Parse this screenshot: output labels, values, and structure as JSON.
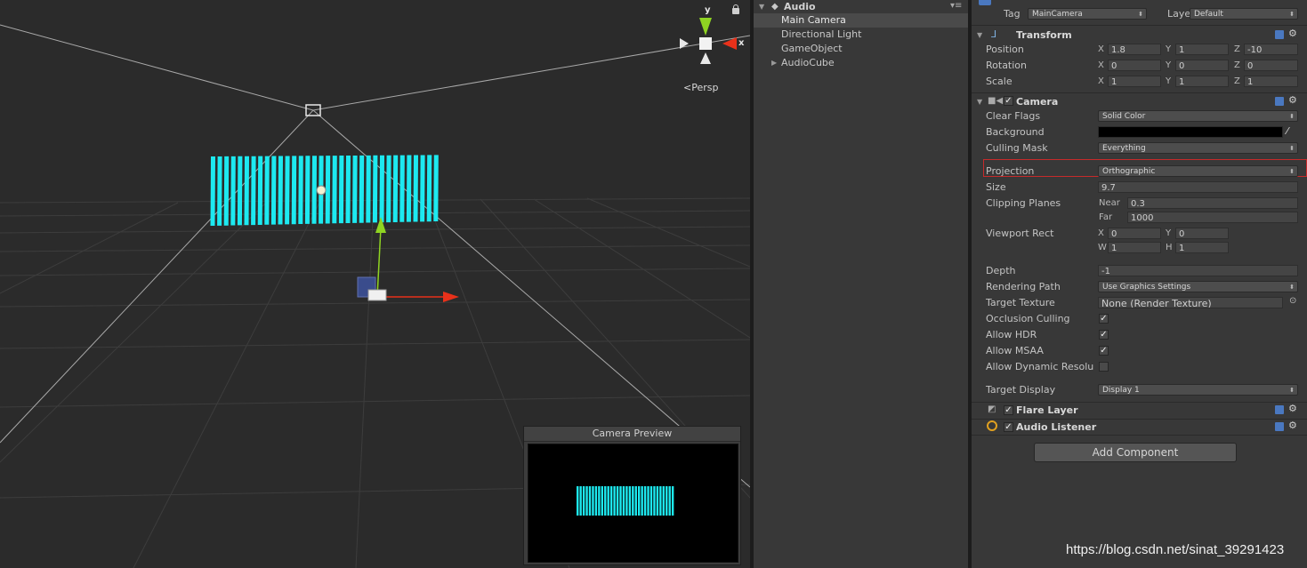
{
  "scene": {
    "persp_label": "Persp",
    "gizmo": {
      "y": "y",
      "x": "x"
    },
    "preview_title": "Camera Preview"
  },
  "hierarchy": {
    "scene_name": "Audio",
    "items": [
      {
        "label": "Main Camera"
      },
      {
        "label": "Directional Light"
      },
      {
        "label": "GameObject"
      },
      {
        "label": "AudioCube"
      }
    ]
  },
  "inspector": {
    "tag_label": "Tag",
    "tag_value": "MainCamera",
    "layer_label": "Layer",
    "layer_value": "Default",
    "transform": {
      "title": "Transform",
      "position": {
        "label": "Position",
        "x": "1.8",
        "y": "1",
        "z": "-10"
      },
      "rotation": {
        "label": "Rotation",
        "x": "0",
        "y": "0",
        "z": "0"
      },
      "scale": {
        "label": "Scale",
        "x": "1",
        "y": "1",
        "z": "1"
      },
      "axes": {
        "x": "X",
        "y": "Y",
        "z": "Z"
      }
    },
    "camera": {
      "title": "Camera",
      "clear_flags": {
        "label": "Clear Flags",
        "value": "Solid Color"
      },
      "background": {
        "label": "Background",
        "color": "#000000"
      },
      "culling_mask": {
        "label": "Culling Mask",
        "value": "Everything"
      },
      "projection": {
        "label": "Projection",
        "value": "Orthographic"
      },
      "size": {
        "label": "Size",
        "value": "9.7"
      },
      "clipping": {
        "label": "Clipping Planes",
        "near_label": "Near",
        "near": "0.3",
        "far_label": "Far",
        "far": "1000"
      },
      "viewport": {
        "label": "Viewport Rect",
        "x_label": "X",
        "x": "0",
        "y_label": "Y",
        "y": "0",
        "w_label": "W",
        "w": "1",
        "h_label": "H",
        "h": "1"
      },
      "depth": {
        "label": "Depth",
        "value": "-1"
      },
      "rendering_path": {
        "label": "Rendering Path",
        "value": "Use Graphics Settings"
      },
      "target_texture": {
        "label": "Target Texture",
        "value": "None (Render Texture)"
      },
      "occlusion_culling": {
        "label": "Occlusion Culling",
        "checked": true
      },
      "allow_hdr": {
        "label": "Allow HDR",
        "checked": true
      },
      "allow_msaa": {
        "label": "Allow MSAA",
        "checked": true
      },
      "allow_dynamic": {
        "label": "Allow Dynamic Resolu",
        "checked": false
      },
      "target_display": {
        "label": "Target Display",
        "value": "Display 1"
      }
    },
    "flare_layer": {
      "title": "Flare Layer"
    },
    "audio_listener": {
      "title": "Audio Listener"
    },
    "add_component": "Add Component"
  },
  "watermark": "https://blog.csdn.net/sinat_39291423",
  "colors": {
    "cyan": "#1de9f0",
    "highlight": "#c62a2a",
    "gizmo_x": "#e8311a",
    "gizmo_y": "#8fd422"
  }
}
